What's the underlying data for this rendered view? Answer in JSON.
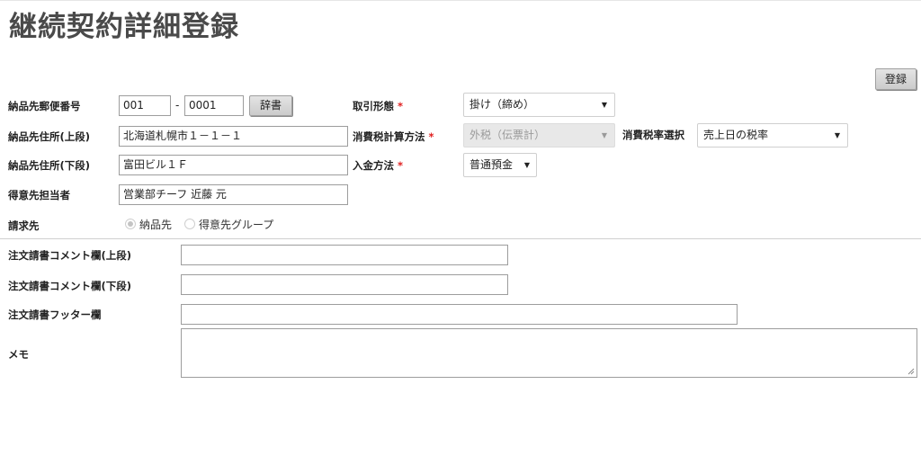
{
  "page": {
    "title": "継続契約詳細登録"
  },
  "toolbar": {
    "register_label": "登録"
  },
  "form": {
    "postal": {
      "label": "納品先郵便番号",
      "part1": "001",
      "separator": "-",
      "part2": "0001",
      "dict_button": "辞書"
    },
    "address_upper": {
      "label": "納品先住所(上段)",
      "value": "北海道札幌市１－１－１"
    },
    "address_lower": {
      "label": "納品先住所(下段)",
      "value": "富田ビル１Ｆ"
    },
    "contact": {
      "label": "得意先担当者",
      "value": "営業部チーフ 近藤 元"
    },
    "billing": {
      "label": "請求先",
      "options": [
        "納品先",
        "得意先グループ"
      ],
      "selected": "納品先"
    },
    "transaction_type": {
      "label": "取引形態",
      "required_mark": "*",
      "value": "掛け（締め）"
    },
    "tax_calc": {
      "label": "消費税計算方法",
      "required_mark": "*",
      "value": "外税（伝票計）"
    },
    "tax_rate": {
      "label": "消費税率選択",
      "value": "売上日の税率"
    },
    "payment": {
      "label": "入金方法",
      "required_mark": "*",
      "value": "普通預金"
    },
    "comment_upper": {
      "label": "注文請書コメント欄(上段)",
      "value": ""
    },
    "comment_lower": {
      "label": "注文請書コメント欄(下段)",
      "value": ""
    },
    "footer": {
      "label": "注文請書フッター欄",
      "value": ""
    },
    "memo": {
      "label": "メモ",
      "value": ""
    }
  },
  "icons": {
    "dropdown": "chevron-down-icon",
    "resize": "resize-grip-icon"
  }
}
